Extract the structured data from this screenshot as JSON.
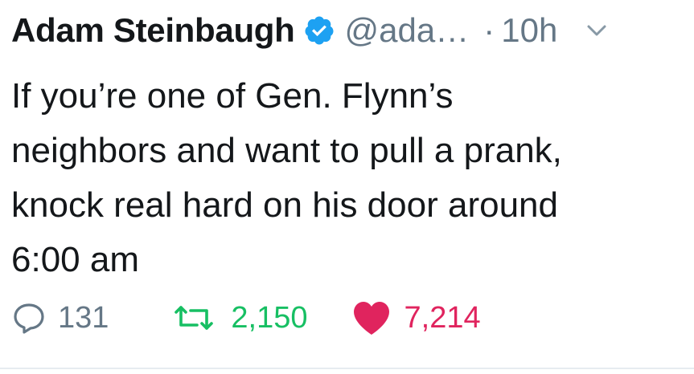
{
  "tweet": {
    "author": {
      "display_name": "Adam Steinbaugh",
      "handle": "@ada…",
      "verified": true
    },
    "separator": "·",
    "time": "10h",
    "body_lines": [
      "If you’re one of Gen. Flynn’s",
      "neighbors and want to pull a prank,",
      "knock real hard on his door around",
      "6:00 am"
    ],
    "actions": {
      "replies": "131",
      "retweets": "2,150",
      "likes": "7,214"
    }
  },
  "colors": {
    "text": "#14171a",
    "muted": "#657786",
    "verified_blue": "#1da1f2",
    "retweet_green": "#17bf63",
    "like_red": "#e0245e"
  },
  "icons": {
    "verified": "verified-badge-icon",
    "caret": "chevron-down-icon",
    "reply": "reply-icon",
    "retweet": "retweet-icon",
    "like": "heart-icon"
  }
}
